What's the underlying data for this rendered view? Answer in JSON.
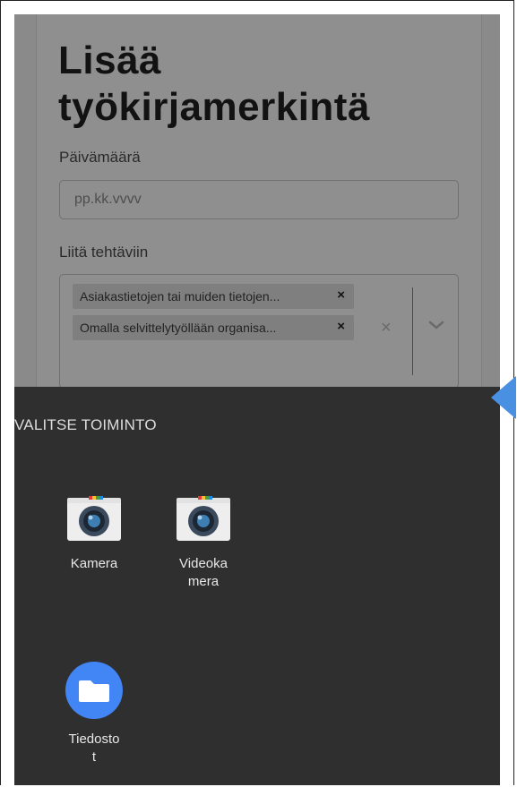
{
  "form": {
    "title": "Lisää työkirjamerkintä",
    "date_label": "Päivämäärä",
    "date_placeholder": "pp.kk.vvvv",
    "tasks_label": "Liitä tehtäviin",
    "chips": [
      {
        "label": "Asiakastietojen tai muiden tietojen..."
      },
      {
        "label": "Omalla selvittelytyöllään organisa..."
      }
    ],
    "chip_remove_glyph": "×",
    "clear_glyph": "×"
  },
  "chooser": {
    "title": "VALITSE TOIMINTO",
    "apps": [
      {
        "label": "Kamera",
        "icon": "camera-icon"
      },
      {
        "label": "Videoka\nmera",
        "icon": "camera-icon"
      },
      {
        "label": "Tiedosto\nt",
        "icon": "folder-icon"
      }
    ]
  },
  "colors": {
    "sheet_bg": "#2f2f2f",
    "files_blue": "#4285f4",
    "pointer_blue": "#4a90e2"
  }
}
